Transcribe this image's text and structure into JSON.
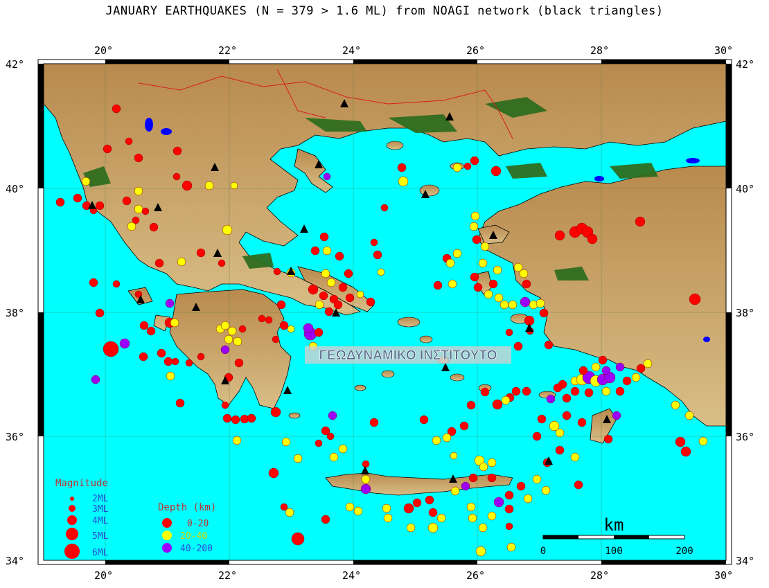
{
  "title": "JANUARY EARTHQUAKES (N = 379 > 1.6 ML) from NOAGI network (black triangles)",
  "watermark": "ΓΕΩΔΥΝΑΜΙΚΟ ΙΝΣΤΙΤΟΥΤΟ",
  "axes": {
    "lon_ticks": [
      "20°",
      "22°",
      "24°",
      "26°",
      "28°",
      "30°"
    ],
    "lat_ticks": [
      "42°",
      "40°",
      "38°",
      "36°",
      "34°"
    ]
  },
  "magnitude_legend": {
    "title": "Magnitude",
    "items": [
      "2ML",
      "3ML",
      "4ML",
      "5ML",
      "6ML"
    ]
  },
  "depth_legend": {
    "title": "Depth (km)",
    "items": [
      {
        "label": "0-20",
        "color": "#ff0000"
      },
      {
        "label": "20-40",
        "color": "#ffff00"
      },
      {
        "label": "40-200",
        "color": "#9b00ff"
      }
    ]
  },
  "scale_bar": {
    "unit": "km",
    "labels": [
      "0",
      "100",
      "200"
    ]
  },
  "colors": {
    "sea": "#00ffff",
    "lowland": "#2f6e1f",
    "upland": "#d2b07a",
    "highland": "#9b6b3c"
  }
}
